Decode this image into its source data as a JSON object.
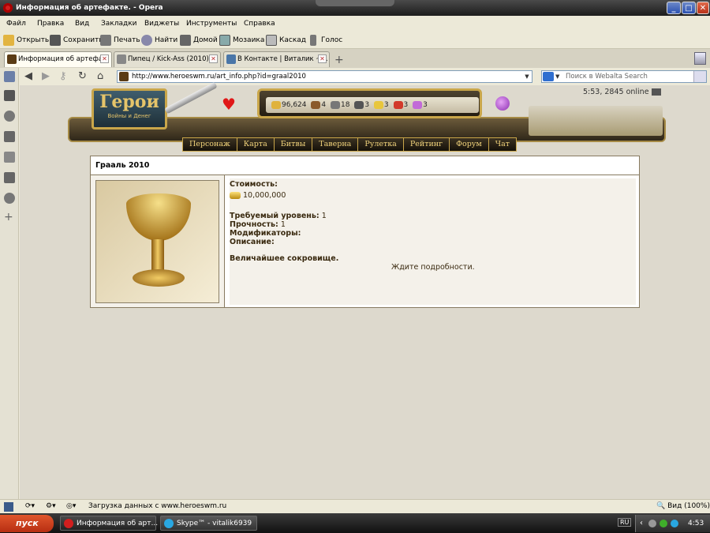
{
  "window": {
    "title": "Информация об артефакте. - Opera"
  },
  "menubar": [
    "Файл",
    "Правка",
    "Вид",
    "Закладки",
    "Виджеты",
    "Инструменты",
    "Справка"
  ],
  "toolbar": {
    "open": "Открыть",
    "save": "Сохранить",
    "print": "Печать",
    "find": "Найти",
    "home": "Домой",
    "mosaic": "Мозаика",
    "cascade": "Каскад",
    "voice": "Голос"
  },
  "tabs": [
    {
      "label": "Информация об артефа...",
      "active": true
    },
    {
      "label": "Пипец / Kick-Ass (2010) ...",
      "active": false
    },
    {
      "label": "В Контакте | Виталик ~...",
      "active": false
    }
  ],
  "address": {
    "url": "http://www.heroeswm.ru/art_info.php?id=graal2010"
  },
  "search": {
    "placeholder": "Поиск в Webalta Search"
  },
  "game": {
    "logo_title": "Герои",
    "logo_sub": "Войны и Денег",
    "online": "5:53, 2845 online",
    "resources": [
      "96,624",
      "4",
      "18",
      "3",
      "3",
      "3",
      "3"
    ],
    "menu": [
      "Персонаж",
      "Карта",
      "Битвы",
      "Таверна",
      "Рулетка",
      "Рейтинг",
      "Форум",
      "Чат"
    ]
  },
  "artifact": {
    "name": "Грааль 2010",
    "cost_label": "Стоимость:",
    "cost_value": "10,000,000",
    "level_label": "Требуемый уровень:",
    "level_value": "1",
    "durability_label": "Прочность:",
    "durability_value": "1",
    "modifiers_label": "Модификаторы:",
    "description_label": "Описание:",
    "description": "Величайшее сокровище.",
    "details": "Ждите подробности."
  },
  "status": {
    "text": "Загрузка данных с www.heroeswm.ru",
    "zoom": "Вид (100%)"
  },
  "taskbar": {
    "start": "пуск",
    "tasks": [
      "Информация об арт...",
      "Skype™ - vitalik6939"
    ],
    "lang": "RU",
    "time": "4:53"
  }
}
